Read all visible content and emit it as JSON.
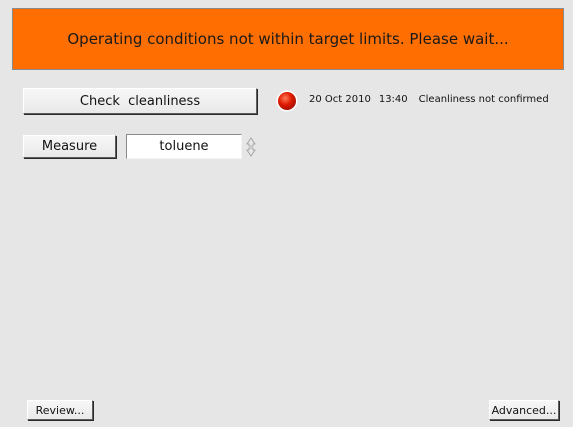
{
  "banner": {
    "message": "Operating conditions not within target limits. Please wait...",
    "color": "#ff6e00"
  },
  "controls": {
    "check_button_label": "Check  cleanliness",
    "measure_button_label": "Measure",
    "solvent_value": "toluene"
  },
  "status": {
    "indicator_color": "#e01b00",
    "date": "20 Oct 2010",
    "time": "13:40",
    "message": "Cleanliness not confirmed"
  },
  "footer": {
    "review_label": "Review...",
    "advanced_label": "Advanced..."
  },
  "icons": {
    "status_indicator": "red-circle-icon",
    "spin_arrows": "up-down-arrows-icon"
  }
}
